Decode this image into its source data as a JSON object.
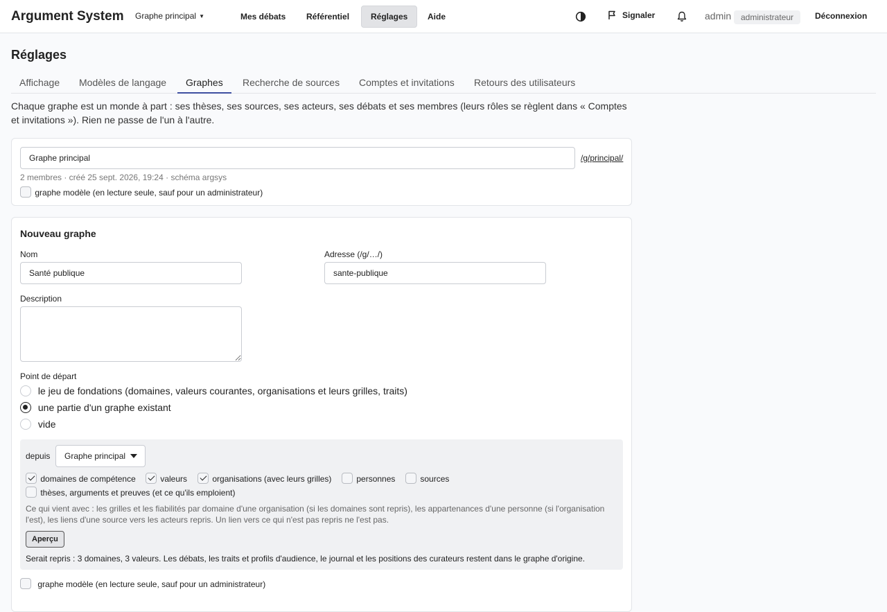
{
  "header": {
    "brand": "Argument System",
    "graph_selector": "Graphe principal",
    "nav": [
      "Mes débats",
      "Référentiel",
      "Réglages",
      "Aide"
    ],
    "active_nav": "Réglages",
    "report": "Signaler",
    "user": "admin",
    "role": "administrateur",
    "logout": "Déconnexion"
  },
  "page": {
    "title": "Réglages",
    "tabs": [
      "Affichage",
      "Modèles de langage",
      "Graphes",
      "Recherche de sources",
      "Comptes et invitations",
      "Retours des utilisateurs"
    ],
    "active_tab": "Graphes",
    "intro": "Chaque graphe est un monde à part : ses thèses, ses sources, ses acteurs, ses débats et ses membres (leurs rôles se règlent dans « Comptes et invitations »). Rien ne passe de l'un à l'autre."
  },
  "existing_graph": {
    "name": "Graphe principal",
    "path": "/g/principal/",
    "meta": "2 membres · créé 25 sept. 2026, 19:24 · schéma argsys",
    "template_label": "graphe modèle (en lecture seule, sauf pour un administrateur)",
    "template_checked": false
  },
  "new_graph": {
    "heading": "Nouveau graphe",
    "name_label": "Nom",
    "name_value": "Santé publique",
    "address_label": "Adresse (/g/…/)",
    "address_value": "sante-publique",
    "description_label": "Description",
    "description_value": "",
    "start_label": "Point de départ",
    "start_options": [
      {
        "label": "le jeu de fondations (domaines, valeurs courantes, organisations et leurs grilles, traits)",
        "selected": false
      },
      {
        "label": "une partie d'un graphe existant",
        "selected": true
      },
      {
        "label": "vide",
        "selected": false
      }
    ],
    "from_label": "depuis",
    "from_value": "Graphe principal",
    "include": [
      {
        "label": "domaines de compétence",
        "checked": true
      },
      {
        "label": "valeurs",
        "checked": true
      },
      {
        "label": "organisations (avec leurs grilles)",
        "checked": true
      },
      {
        "label": "personnes",
        "checked": false
      },
      {
        "label": "sources",
        "checked": false
      },
      {
        "label": "thèses, arguments et preuves (et ce qu'ils emploient)",
        "checked": false
      }
    ],
    "note": "Ce qui vient avec : les grilles et les fiabilités par domaine d'une organisation (si les domaines sont repris), les appartenances d'une personne (si l'organisation l'est), les liens d'une source vers les acteurs repris. Un lien vers ce qui n'est pas repris ne l'est pas.",
    "preview_button": "Aperçu",
    "preview_result": "Serait repris : 3 domaines, 3 valeurs. Les débats, les traits et profils d'audience, le journal et les positions des curateurs restent dans le graphe d'origine.",
    "template_label": "graphe modèle (en lecture seule, sauf pour un administrateur)",
    "template_checked": false
  }
}
